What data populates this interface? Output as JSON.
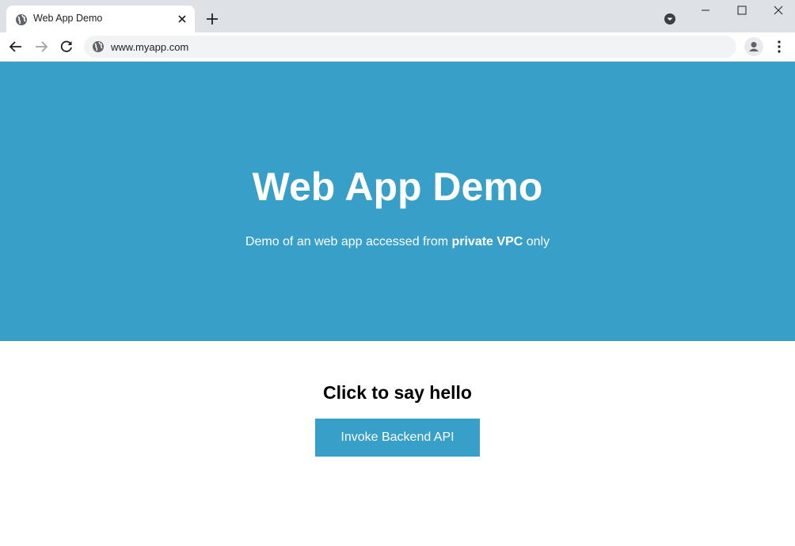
{
  "browser": {
    "tab": {
      "title": "Web App Demo"
    },
    "address_bar": {
      "url": "www.myapp.com"
    }
  },
  "hero": {
    "title": "Web App Demo",
    "subtitle_before": "Demo of an web app accessed from ",
    "subtitle_bold": "private VPC",
    "subtitle_after": " only",
    "background_color": "#379fc8"
  },
  "main": {
    "heading": "Click to say hello",
    "button_label": "Invoke Backend API",
    "button_color": "#379fc8"
  }
}
